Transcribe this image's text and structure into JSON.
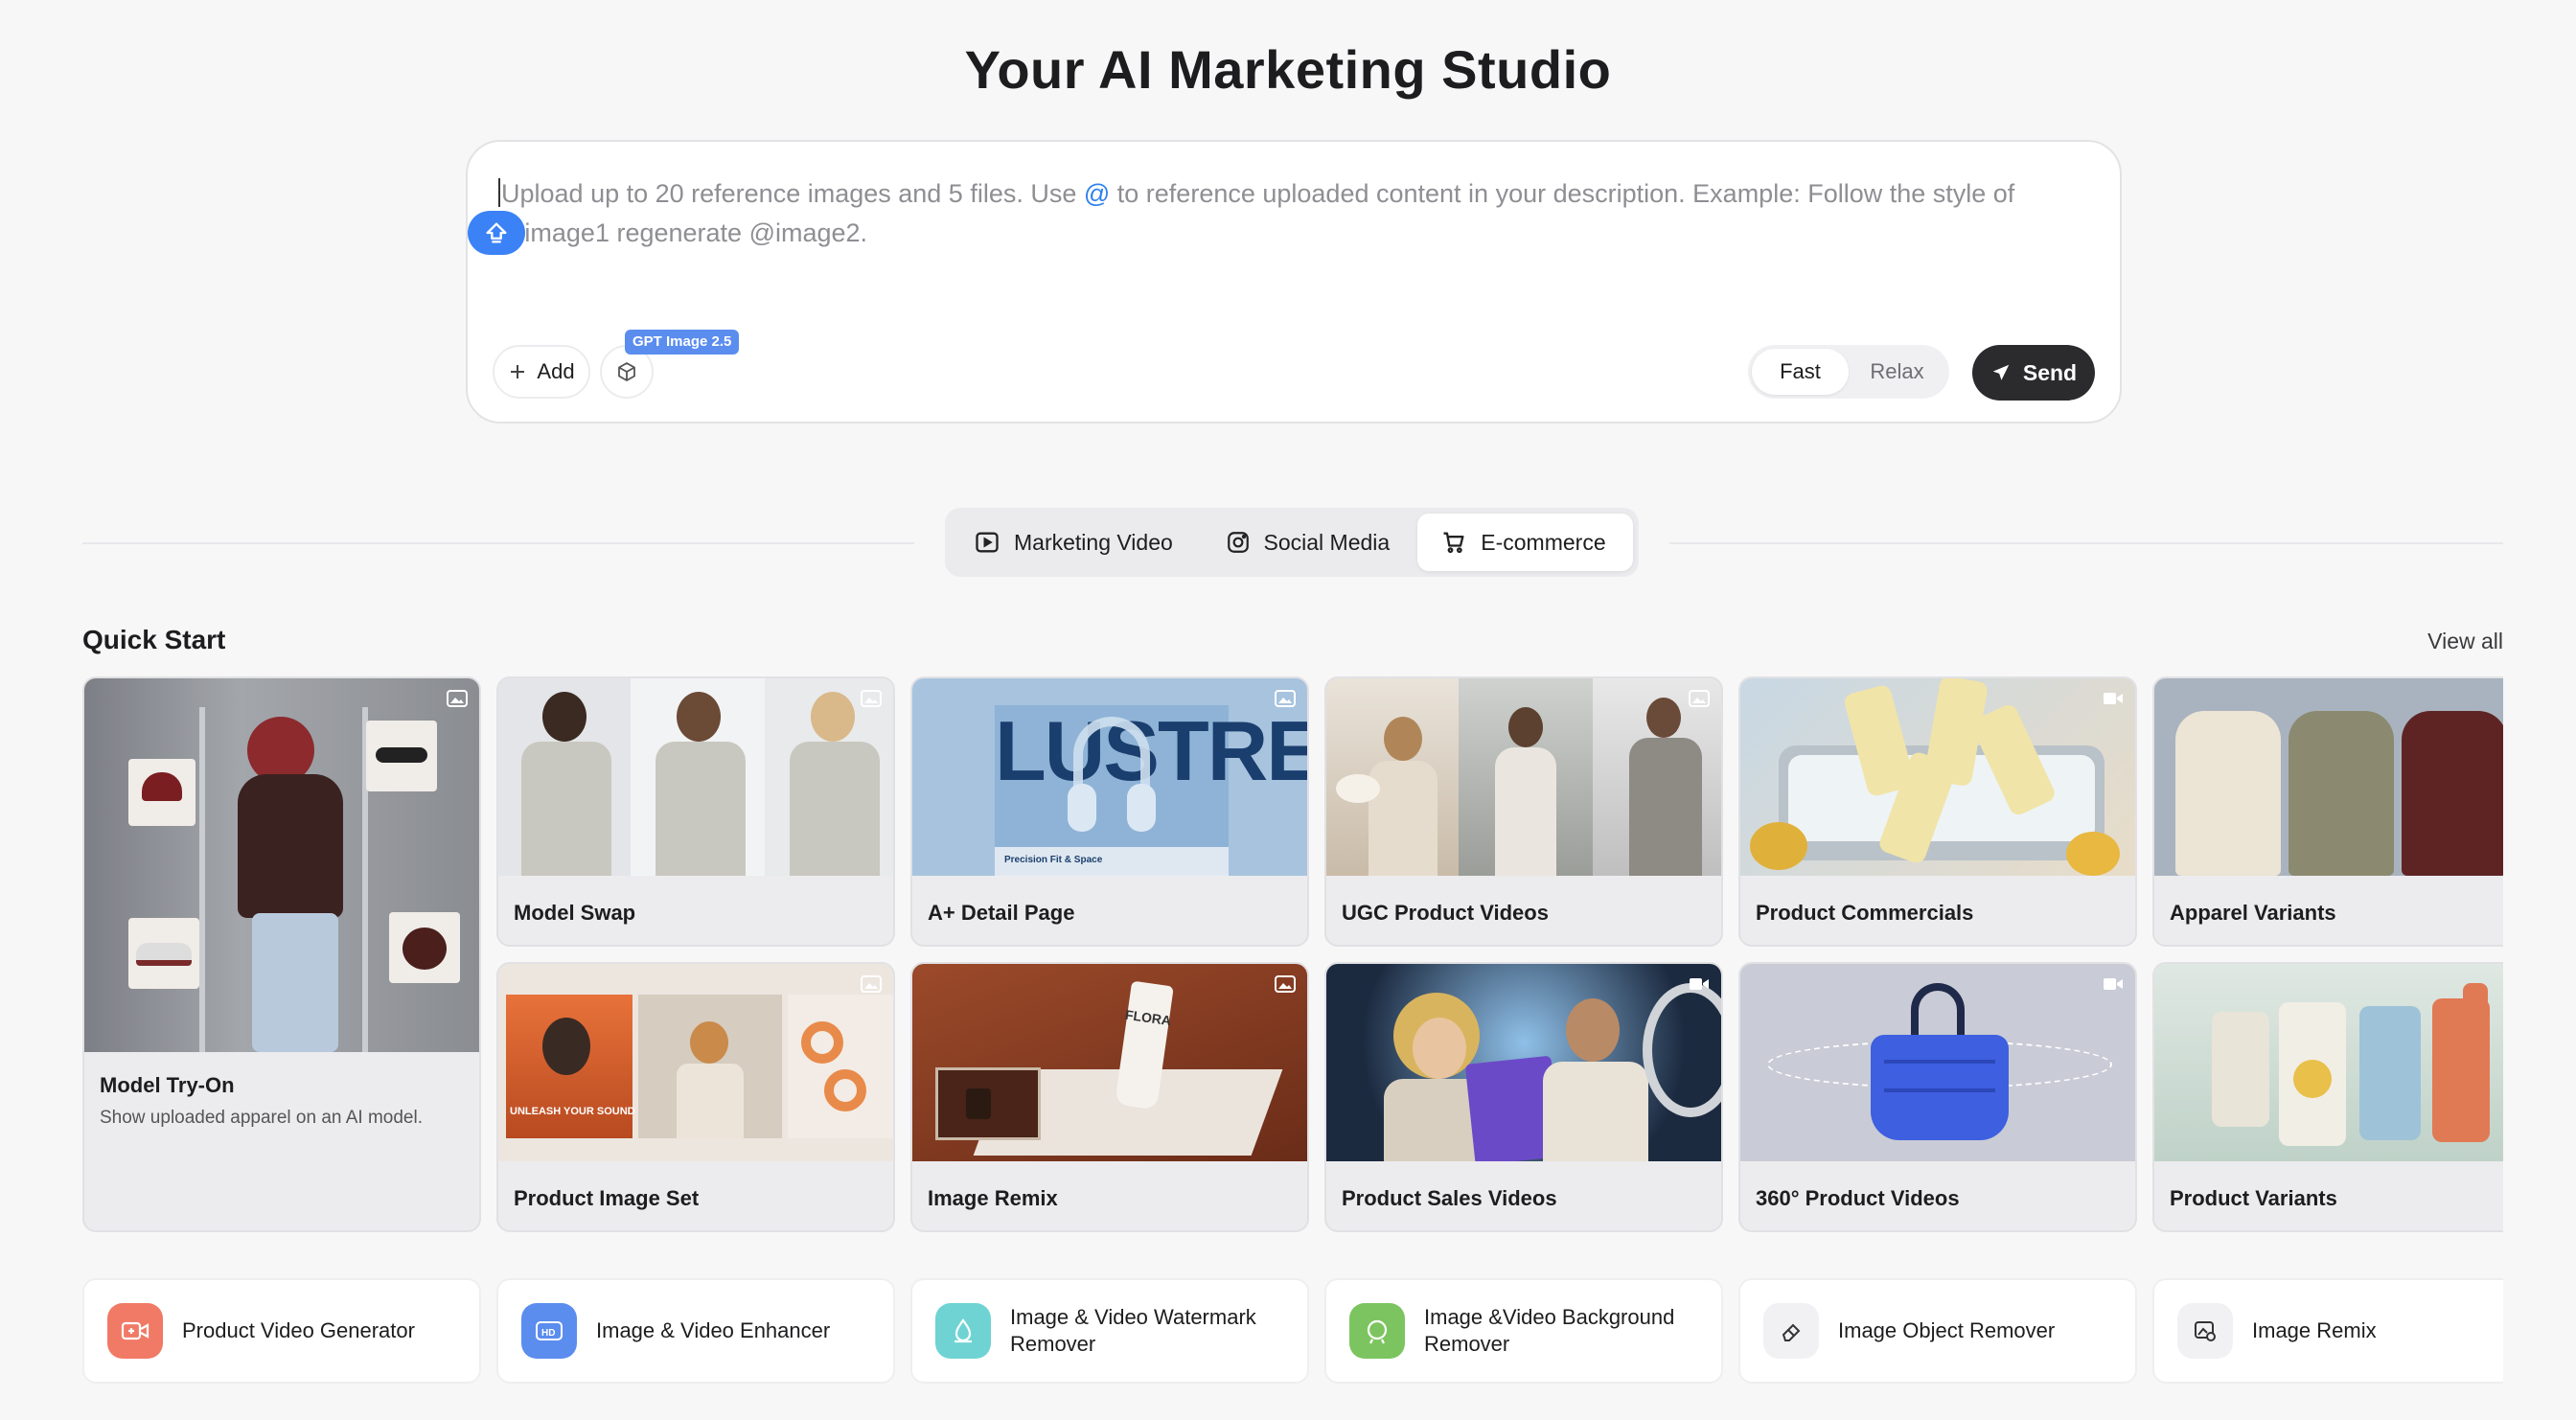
{
  "header": {
    "title": "Your AI Marketing Studio"
  },
  "prompt": {
    "placeholder_pre": "Upload up to 20 reference images and 5 files. Use ",
    "placeholder_at": "@",
    "placeholder_post": " to reference uploaded content in your description. Example: Follow the style of @image1 regenerate @image2.",
    "add_label": "Add",
    "model_badge": "GPT Image 2.5",
    "speed_options": [
      "Fast",
      "Relax"
    ],
    "speed_selected": "Fast",
    "send_label": "Send"
  },
  "tabs": [
    {
      "label": "Marketing Video",
      "icon": "play-square-icon",
      "active": false
    },
    {
      "label": "Social Media",
      "icon": "instagram-icon",
      "active": false
    },
    {
      "label": "E-commerce",
      "icon": "cart-icon",
      "active": true
    }
  ],
  "quick_start": {
    "title": "Quick Start",
    "view_all": "View all",
    "cards": [
      {
        "label": "Model Try-On",
        "desc": "Show uploaded apparel on an AI model.",
        "media": "image",
        "featured": true
      },
      {
        "label": "Model Swap",
        "media": "image"
      },
      {
        "label": "A+ Detail Page",
        "media": "image",
        "art_text": "LUSTRE",
        "art_sub": "Precision Fit & Space"
      },
      {
        "label": "UGC Product Videos",
        "media": "image"
      },
      {
        "label": "Product Commercials",
        "media": "video"
      },
      {
        "label": "Apparel Variants",
        "media": "image"
      },
      {
        "label": "Product Image Set",
        "media": "image",
        "art_text": "UNLEASH YOUR SOUND"
      },
      {
        "label": "Image Remix",
        "media": "image",
        "art_text": "FLORA"
      },
      {
        "label": "Product Sales Videos",
        "media": "video"
      },
      {
        "label": "360° Product Videos",
        "media": "video"
      },
      {
        "label": "Product Variants",
        "media": "image"
      }
    ]
  },
  "tools": [
    {
      "label": "Product Video Generator",
      "icon": "video-plus-icon",
      "color": "#f07a66"
    },
    {
      "label": "Image & Video Enhancer",
      "icon": "hd-icon",
      "color": "#5b8def"
    },
    {
      "label": "Image & Video Watermark Remover",
      "icon": "eraser-drop-icon",
      "color": "#6fd3d3"
    },
    {
      "label": "Image &Video Background Remover",
      "icon": "bg-remove-icon",
      "color": "#7cc45f"
    },
    {
      "label": "Image Object Remover",
      "icon": "object-eraser-icon",
      "color": "#f1f1f3"
    },
    {
      "label": "Image Remix",
      "icon": "image-remix-icon",
      "color": "#f1f1f3"
    }
  ]
}
